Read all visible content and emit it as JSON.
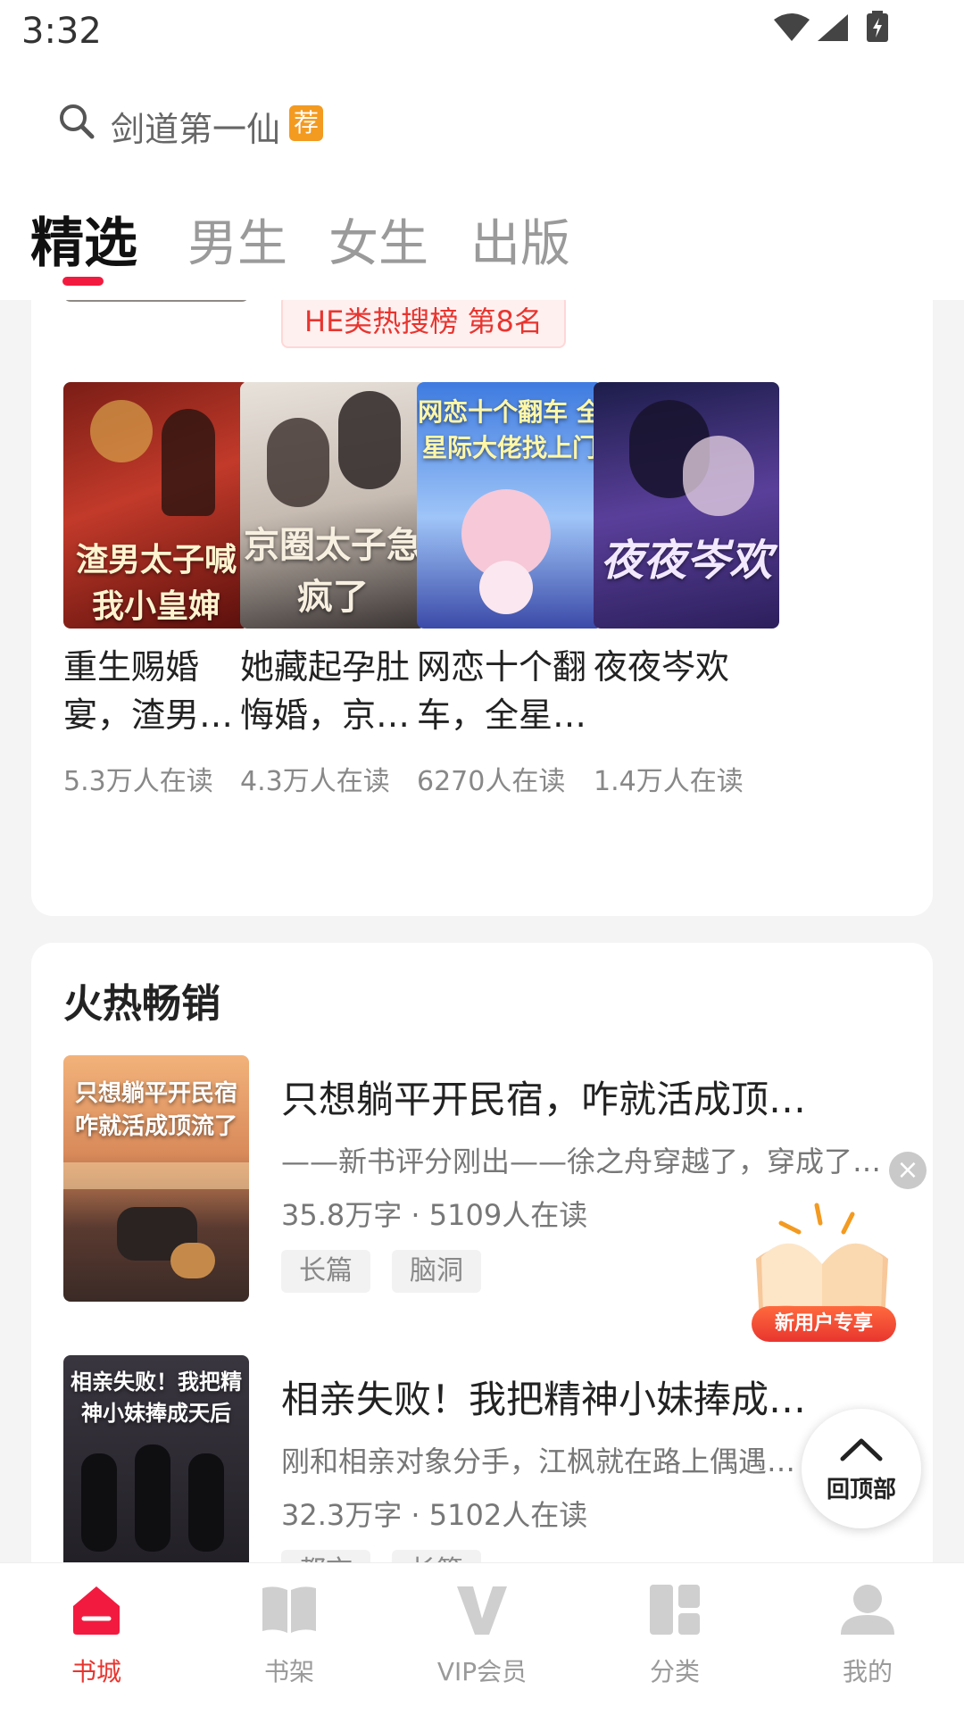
{
  "status_bar": {
    "time": "3:32"
  },
  "search": {
    "placeholder": "剑道第一仙",
    "badge": "荐"
  },
  "tabs": [
    {
      "label": "精选"
    },
    {
      "label": "男生"
    },
    {
      "label": "女生"
    },
    {
      "label": "出版"
    }
  ],
  "prev_book": {
    "hot_rank": "HE类热搜榜  第8名"
  },
  "grid_books": [
    {
      "title": "重生赐婚宴，渣男…",
      "readers": "5.3万人在读",
      "cover_text": "渣男太子喊我小皇婶"
    },
    {
      "title": "她藏起孕肚悔婚，京…",
      "readers": "4.3万人在读",
      "cover_text": "京圈太子急疯了"
    },
    {
      "title": "网恋十个翻车，全星…",
      "readers": "6270人在读",
      "cover_text": "网恋十个翻车 全星际大佬找上门"
    },
    {
      "title": "夜夜岑欢",
      "readers": "1.4万人在读",
      "cover_text": "夜夜岑欢"
    }
  ],
  "hot_section": {
    "title": "火热畅销",
    "books": [
      {
        "title": "只想躺平开民宿，咋就活成顶…",
        "desc": "——新书评分刚出——徐之舟穿越了，穿成了…",
        "meta": "35.8万字 · 5109人在读",
        "tags": [
          "长篇",
          "脑洞"
        ],
        "cover_text": "只想躺平开民宿 咋就活成顶流了"
      },
      {
        "title": "相亲失败！我把精神小妹捧成…",
        "desc": "刚和相亲对象分手，江枫就在路上偶遇…",
        "meta": "32.3万字 · 5102人在读",
        "tags": [
          "都市",
          "长篇"
        ],
        "cover_text": "相亲失败！我把精神小妹捧成天后"
      }
    ]
  },
  "floating": {
    "new_user": "新用户专享",
    "back_top": "回顶部",
    "close": "×"
  },
  "bottom_nav": [
    {
      "label": "书城",
      "icon": "bookstore-icon"
    },
    {
      "label": "书架",
      "icon": "bookshelf-icon"
    },
    {
      "label": "VIP会员",
      "icon": "vip-icon"
    },
    {
      "label": "分类",
      "icon": "category-icon"
    },
    {
      "label": "我的",
      "icon": "profile-icon"
    }
  ],
  "colors": {
    "accent": "#e8352f",
    "badge": "#f39a21"
  }
}
